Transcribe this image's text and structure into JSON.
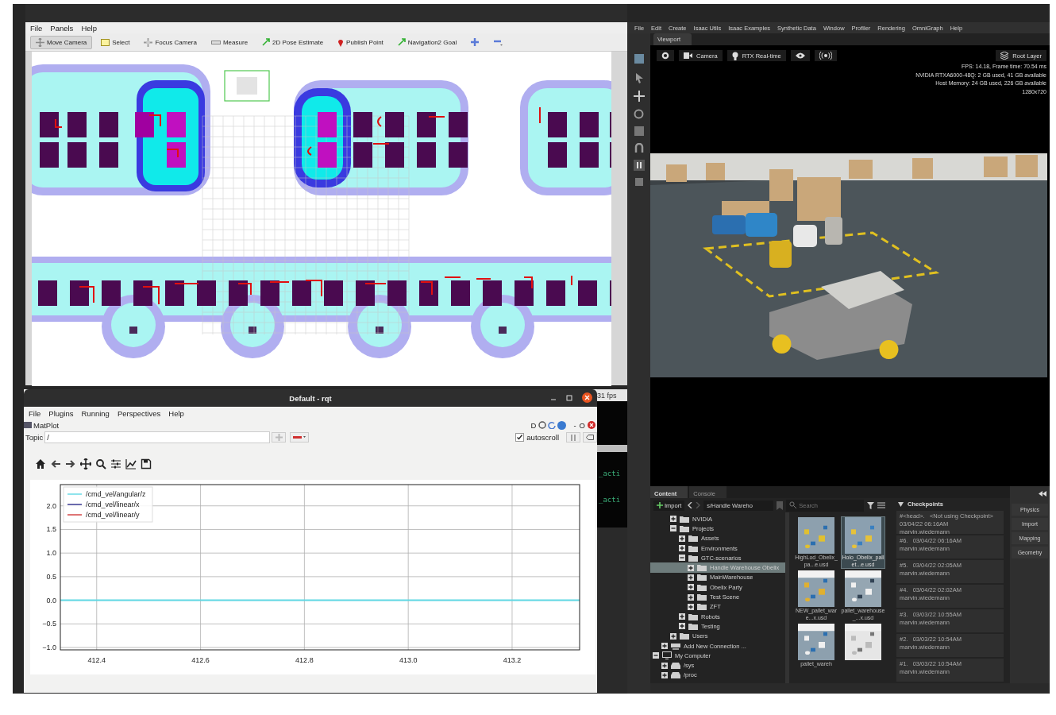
{
  "rviz": {
    "menu": [
      "File",
      "Panels",
      "Help"
    ],
    "tools": [
      {
        "kind": "move",
        "label": "Move Camera",
        "selected": true
      },
      {
        "kind": "select",
        "label": "Select",
        "selected": false
      },
      {
        "kind": "focus",
        "label": "Focus Camera",
        "selected": false
      },
      {
        "kind": "measure",
        "label": "Measure",
        "selected": false
      },
      {
        "kind": "pose",
        "label": "2D Pose Estimate",
        "selected": false
      },
      {
        "kind": "point",
        "label": "Publish Point",
        "selected": false
      },
      {
        "kind": "goal",
        "label": "Navigation2 Goal",
        "selected": false
      },
      {
        "kind": "add",
        "selected": false
      },
      {
        "kind": "remove",
        "selected": false
      }
    ]
  },
  "rqt": {
    "title": "Default - rqt",
    "menu": [
      "File",
      "Plugins",
      "Running",
      "Perspectives",
      "Help"
    ],
    "plugin": {
      "title": "MatPlot",
      "buttons": [
        "D",
        "-",
        "O"
      ]
    },
    "topic": {
      "label": "Topic",
      "value": "/"
    },
    "autoscroll": {
      "label": "autoscroll",
      "checked": true
    },
    "chart_data": {
      "type": "line",
      "x": [
        412.33,
        413.33
      ],
      "series": [
        {
          "name": "/cmd_vel/angular/z",
          "color": "#5fd8e4",
          "values": [
            0,
            0
          ]
        },
        {
          "name": "/cmd_vel/linear/x",
          "color": "#2a2a8a",
          "values": [
            null,
            null
          ]
        },
        {
          "name": "/cmd_vel/linear/y",
          "color": "#d23a3a",
          "values": [
            null,
            null
          ]
        }
      ],
      "grid": true,
      "legend": true,
      "xlim": [
        412.33,
        413.33
      ],
      "ylim": [
        -1.05,
        2.45
      ],
      "xticks": [
        412.4,
        412.6,
        412.8,
        {
          "value": 413,
          "label": "413.0"
        },
        413.2
      ],
      "yticks": [
        {
          "value": -1,
          "label": "−1.0"
        },
        {
          "value": -0.5,
          "label": "−0.5"
        },
        {
          "value": 0,
          "label": "0.0"
        },
        0.5,
        {
          "value": 1,
          "label": "1.0"
        },
        1.5,
        {
          "value": 2,
          "label": "2.0"
        }
      ]
    }
  },
  "terminal": {
    "lines": [
      "31 fps",
      "_acti",
      "_acti"
    ]
  },
  "isaac": {
    "menu": [
      "File",
      "Edit",
      "Create",
      "Isaac Utils",
      "Isaac Examples",
      "Synthetic Data",
      "Window",
      "Profiler",
      "Rendering",
      "OmniGraph",
      "Help"
    ],
    "viewport": {
      "tab": "Viewport",
      "buttons": [
        {
          "kind": "settings"
        },
        {
          "kind": "camera",
          "label": "Camera"
        },
        {
          "kind": "render",
          "label": "RTX Real-time"
        },
        {
          "kind": "visibility"
        },
        {
          "kind": "broadcast"
        }
      ],
      "layer": "Root Layer",
      "stats": [
        "FPS: 14.18, Frame time: 70.54 ms",
        "NVIDIA RTXA6000-48Q: 2 GB used,  41 GB available",
        "Host Memory: 24 GB used, 226 GB available",
        "1280x720"
      ]
    },
    "content": {
      "tabs": [
        {
          "label": "Content",
          "selected": true
        },
        {
          "label": "Console",
          "selected": false
        }
      ],
      "import": "Import",
      "path": "s/Handle Wareho",
      "search_placeholder": "Search",
      "tree": [
        {
          "children": [
            {
              "children": [
                {
                  "kind": "folder",
                  "label": "NVIDIA",
                  "expanded": false,
                  "selected": false
                },
                {
                  "kind": "folder",
                  "label": "Projects",
                  "expanded": true,
                  "selected": false,
                  "children": [
                    {
                      "kind": "folder",
                      "label": "Assets",
                      "expanded": false,
                      "selected": false
                    },
                    {
                      "kind": "folder",
                      "label": "Environments",
                      "expanded": false,
                      "selected": false
                    },
                    {
                      "kind": "folder",
                      "label": "GTC-scenarios",
                      "expanded": true,
                      "selected": false,
                      "children": [
                        {
                          "kind": "folder",
                          "label": "Handle Warehouse Obelix",
                          "expanded": false,
                          "selected": true
                        },
                        {
                          "kind": "folder",
                          "label": "MainWarehouse",
                          "expanded": false,
                          "selected": false
                        },
                        {
                          "kind": "folder",
                          "label": "Obelix Party",
                          "expanded": false,
                          "selected": false
                        },
                        {
                          "kind": "folder",
                          "label": "Test Scene",
                          "expanded": false,
                          "selected": false
                        },
                        {
                          "kind": "folder",
                          "label": "ZFT",
                          "expanded": false,
                          "selected": false
                        }
                      ]
                    },
                    {
                      "kind": "folder",
                      "label": "Robots",
                      "expanded": false,
                      "selected": false
                    },
                    {
                      "kind": "folder",
                      "label": "Testing",
                      "expanded": false,
                      "selected": false
                    }
                  ]
                },
                {
                  "kind": "folder",
                  "label": "Users",
                  "expanded": false,
                  "selected": false
                }
              ]
            },
            {
              "kind": "server",
              "label": "Add New Connection ...",
              "expanded": false,
              "selected": false
            }
          ]
        },
        {
          "kind": "computer",
          "label": "My Computer",
          "expanded": true,
          "selected": false,
          "children": [
            {
              "kind": "drive",
              "label": "/sys",
              "expanded": false,
              "selected": false
            },
            {
              "kind": "drive",
              "label": "/proc",
              "expanded": false,
              "selected": false
            }
          ]
        }
      ],
      "files": [
        {
          "label": "HighLod_Obelix_pa...e.usd",
          "selected": false
        },
        {
          "label": "Holo_Obelix_pallet...e.usd",
          "selected": true
        },
        {
          "label": "NEW_pallet_ware...x.usd",
          "selected": false
        },
        {
          "label": "pallet_warehouse_...x.usd",
          "selected": false
        },
        {
          "label": "pallet_wareh",
          "selected": false
        },
        {
          "selected": false
        }
      ],
      "checkpoints_title": "Checkpoints",
      "checkpoints": [
        {
          "name": "#<head>.",
          "note": "<Not using Checkpoint>",
          "date": "03/04/22 06:16AM",
          "user": "marvin.wiedemann"
        },
        {
          "name": "#6.",
          "date": "03/04/22 06:16AM",
          "user": "marvin.wiedemann"
        },
        {
          "name": "#5.",
          "date": "03/04/22 02:05AM",
          "user": "marvin.wiedemann"
        },
        {
          "name": "#4.",
          "date": "03/04/22 02:02AM",
          "user": "marvin.wiedemann"
        },
        {
          "name": "#3.",
          "date": "03/03/22 10:55AM",
          "user": "marvin.wiedemann"
        },
        {
          "name": "#2.",
          "date": "03/03/22 10:54AM",
          "user": "marvin.wiedemann"
        },
        {
          "name": "#1.",
          "date": "03/03/22 10:54AM",
          "user": "marvin.wiedemann"
        }
      ],
      "side_buttons": [
        "Physics",
        "Import",
        "Mapping",
        "Geometry"
      ]
    }
  }
}
